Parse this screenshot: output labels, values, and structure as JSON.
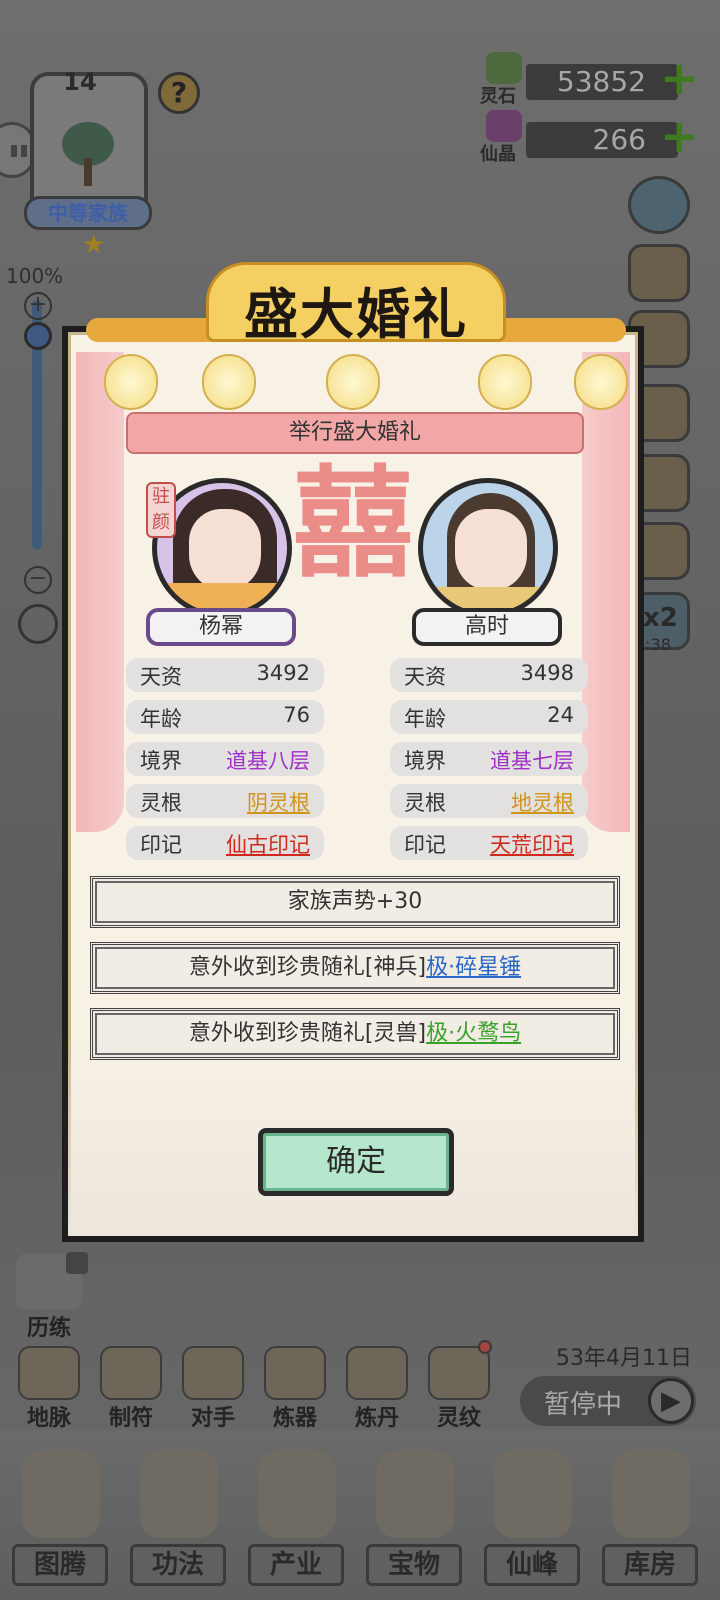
{
  "family": {
    "level": "14",
    "name": "中等家族",
    "help_label": "?"
  },
  "resources": [
    {
      "name": "灵石",
      "value": "53852",
      "plus": "+"
    },
    {
      "name": "仙晶",
      "value": "266",
      "plus": "+"
    }
  ],
  "zoom": {
    "label": "100%",
    "plus": "+",
    "minus": "−"
  },
  "dialog": {
    "title": "盛大婚礼",
    "subtitle": "举行盛大婚礼",
    "decor_char": "囍",
    "seal": "驻颜",
    "bride": {
      "name": "杨幂",
      "stats": [
        {
          "key": "天资",
          "value": "3492"
        },
        {
          "key": "年龄",
          "value": "76"
        },
        {
          "key": "境界",
          "value": "道基八层"
        },
        {
          "key": "灵根",
          "value": "阴灵根"
        },
        {
          "key": "印记",
          "value": "仙古印记"
        }
      ]
    },
    "groom": {
      "name": "高时",
      "stats": [
        {
          "key": "天资",
          "value": "3498"
        },
        {
          "key": "年龄",
          "value": "24"
        },
        {
          "key": "境界",
          "value": "道基七层"
        },
        {
          "key": "灵根",
          "value": "地灵根"
        },
        {
          "key": "印记",
          "value": "天荒印记"
        }
      ]
    },
    "results": {
      "r1": "家族声势+30",
      "r2_prefix": "意外收到珍贵随礼[神兵]",
      "r2_link": "极·碎星锤",
      "r3_prefix": "意外收到珍贵随礼[灵兽]",
      "r3_link": "极·火鹜鸟"
    },
    "confirm": "确定"
  },
  "side": {
    "timer_badge": "x2",
    "timer": "0:38"
  },
  "training": "历练",
  "date": "53年4月11日",
  "pause": {
    "label": "暂停中",
    "play": "▶"
  },
  "tools": [
    "地脉",
    "制符",
    "对手",
    "炼器",
    "炼丹",
    "灵纹"
  ],
  "nav": [
    "图腾",
    "功法",
    "产业",
    "宝物",
    "仙峰",
    "库房"
  ],
  "colors": {
    "purple_realm": "#a030c8",
    "gold_root": "#d2931a",
    "red_mark": "#d02a1e",
    "blue_link": "#2866c8",
    "green_link": "#38a22c",
    "confirm_bg": "#b6e6cc"
  }
}
